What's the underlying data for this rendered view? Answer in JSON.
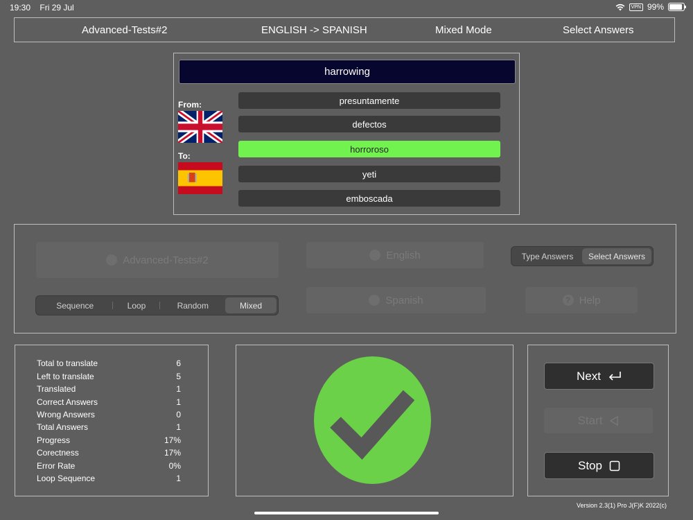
{
  "status_bar": {
    "time": "19:30",
    "date": "Fri 29 Jul",
    "vpn": "VPN",
    "battery": "99%",
    "battery_level": 0.99
  },
  "header": {
    "test_name": "Advanced-Tests#2",
    "direction": "ENGLISH -> SPANISH",
    "mode": "Mixed Mode",
    "answer_mode": "Select Answers"
  },
  "question": {
    "word": "harrowing",
    "from_label": "From:",
    "to_label": "To:",
    "answers": [
      "presuntamente",
      "defectos",
      "horroroso",
      "yeti",
      "emboscada"
    ],
    "selected_index": 2
  },
  "settings": {
    "test_button": "Advanced-Tests#2",
    "from_language": "English",
    "to_language": "Spanish",
    "help": "Help",
    "answer_modes": [
      "Type Answers",
      "Select Answers"
    ],
    "active_answer_mode": "Select Answers",
    "order_modes": [
      "Sequence",
      "Loop",
      "Random",
      "Mixed"
    ],
    "active_order_mode": "Mixed"
  },
  "stats": [
    {
      "label": "Total to translate",
      "value": "6"
    },
    {
      "label": "Left to translate",
      "value": "5"
    },
    {
      "label": "Translated",
      "value": "1"
    },
    {
      "label": "Correct Answers",
      "value": "1"
    },
    {
      "label": "Wrong Answers",
      "value": "0"
    },
    {
      "label": "Total Answers",
      "value": "1"
    },
    {
      "label": "Progress",
      "value": "17%"
    },
    {
      "label": "Corectness",
      "value": "17%"
    },
    {
      "label": "Error Rate",
      "value": "0%"
    },
    {
      "label": "Loop Sequence",
      "value": "1"
    }
  ],
  "result": {
    "state": "correct",
    "color": "#6ad148"
  },
  "controls": {
    "next": "Next",
    "start": "Start",
    "stop": "Stop"
  },
  "version": "Version 2.3(1) Pro J(F)K 2022(c)",
  "colors": {
    "background": "#5e5e5e",
    "word_bar": "#06062e",
    "selected_answer": "#72f24e",
    "answer": "#3a3a3a"
  }
}
